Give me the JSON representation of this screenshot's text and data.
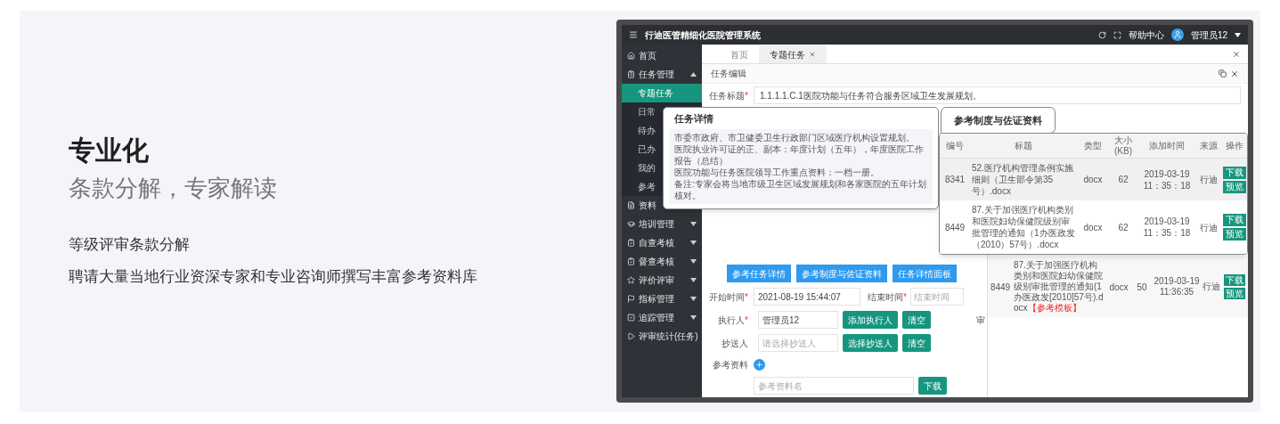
{
  "heading": "专业化",
  "subheading": "条款分解，专家解读",
  "points": [
    "等级评审条款分解",
    "聘请大量当地行业资深专家和专业咨询师撰写丰富参考资料库"
  ],
  "app": {
    "title": "行迪医管精细化医院管理系统",
    "help": "帮助中心",
    "user": "管理员12",
    "sidebar": [
      {
        "label": "首页",
        "kind": "link",
        "selected": false
      },
      {
        "label": "任务管理",
        "kind": "group",
        "expanded": true,
        "selected": false,
        "children": [
          {
            "label": "专题任务",
            "selected": true
          },
          {
            "label": "日常",
            "selected": false
          },
          {
            "label": "待办",
            "selected": false
          },
          {
            "label": "已办",
            "selected": false
          },
          {
            "label": "我的",
            "selected": false
          },
          {
            "label": "参考",
            "selected": false
          }
        ]
      },
      {
        "label": "资料",
        "kind": "link",
        "selected": false
      },
      {
        "label": "培训管理",
        "kind": "group",
        "expanded": false,
        "selected": false
      },
      {
        "label": "自查考核",
        "kind": "group",
        "expanded": false,
        "selected": false
      },
      {
        "label": "督查考核",
        "kind": "group",
        "expanded": false,
        "selected": false
      },
      {
        "label": "评价评审",
        "kind": "group",
        "expanded": false,
        "selected": false
      },
      {
        "label": "指标管理",
        "kind": "group",
        "expanded": false,
        "selected": false
      },
      {
        "label": "追踪管理",
        "kind": "group",
        "expanded": false,
        "selected": false
      },
      {
        "label": "评审统计(任务)",
        "kind": "link",
        "selected": false
      }
    ],
    "tabs": [
      {
        "label": "首页",
        "selected": false,
        "closable": false
      },
      {
        "label": "专题任务",
        "selected": true,
        "closable": true
      }
    ],
    "form": {
      "section": "任务编辑",
      "title_field": {
        "label": "任务标题",
        "mark": "*",
        "value": "1.1.1.1.C.1医院功能与任务符合服务区域卫生发展规划。"
      },
      "actions": [
        "参考任务详情",
        "参考制度与佐证资料",
        "任务详情面板"
      ],
      "start_field": {
        "label": "开始时间",
        "mark": "*",
        "value": "2021-08-19 15:44:07"
      },
      "end_field": {
        "label": "结束时间",
        "mark": "*",
        "placeholder": "结束时间"
      },
      "executor": {
        "label": "执行人",
        "mark": "*",
        "value": "管理员12",
        "buttons": [
          "添加执行人",
          "清空"
        ],
        "extra_label": "审"
      },
      "cc": {
        "label": "抄送人",
        "placeholder": "请选择抄送人",
        "buttons": [
          "选择抄送人",
          "清空"
        ]
      },
      "references": {
        "label": "参考资料",
        "placeholder": "参考资料名",
        "download": "下载"
      }
    },
    "background_row": {
      "id": "8449",
      "title": "87.关于加强医疗机构类别和医院妇幼保健院级别审批管理的通知(1办医政发[2010]57号).docx",
      "tag": "【参考模板】",
      "type": "docx",
      "size": "50",
      "time": "2019-03-19 11:36:35",
      "source": "行迪",
      "actions": [
        "下载",
        "预览"
      ]
    },
    "detail_popup": {
      "title": "任务详情",
      "lines": [
        "市委市政府、市卫健委卫生行政部门区域医疗机构设置规划。",
        "医院执业许可证的正、副本：年度计划（五年），年度医院工作报告（总结）",
        "医院功能与任务医院领导工作重点资料：一档一册。",
        "备注:专家会将当地市级卫生区域发展规划和各家医院的五年计划核对。"
      ]
    },
    "reference_popup": {
      "title": "参考制度与佐证资料",
      "columns": [
        "编号",
        "标题",
        "类型",
        "大小(KB)",
        "添加时间",
        "来源",
        "操作"
      ],
      "rows": [
        {
          "id": "8341",
          "title": "52.医疗机构管理条例实施细则（卫生部令第35号）.docx",
          "type": "docx",
          "size": "62",
          "time": "2019-03-19 11：35：18",
          "source": "行迪",
          "actions": [
            "下载",
            "预览"
          ]
        },
        {
          "id": "8449",
          "title": "87.关于加强医疗机构类别和医院妇幼保健院级别审批管理的通知（1办医政发（2010）57号）.docx",
          "type": "docx",
          "size": "62",
          "time": "2019-03-19 11：35：18",
          "source": "行迪",
          "actions": [
            "下载",
            "预览"
          ]
        }
      ]
    }
  }
}
